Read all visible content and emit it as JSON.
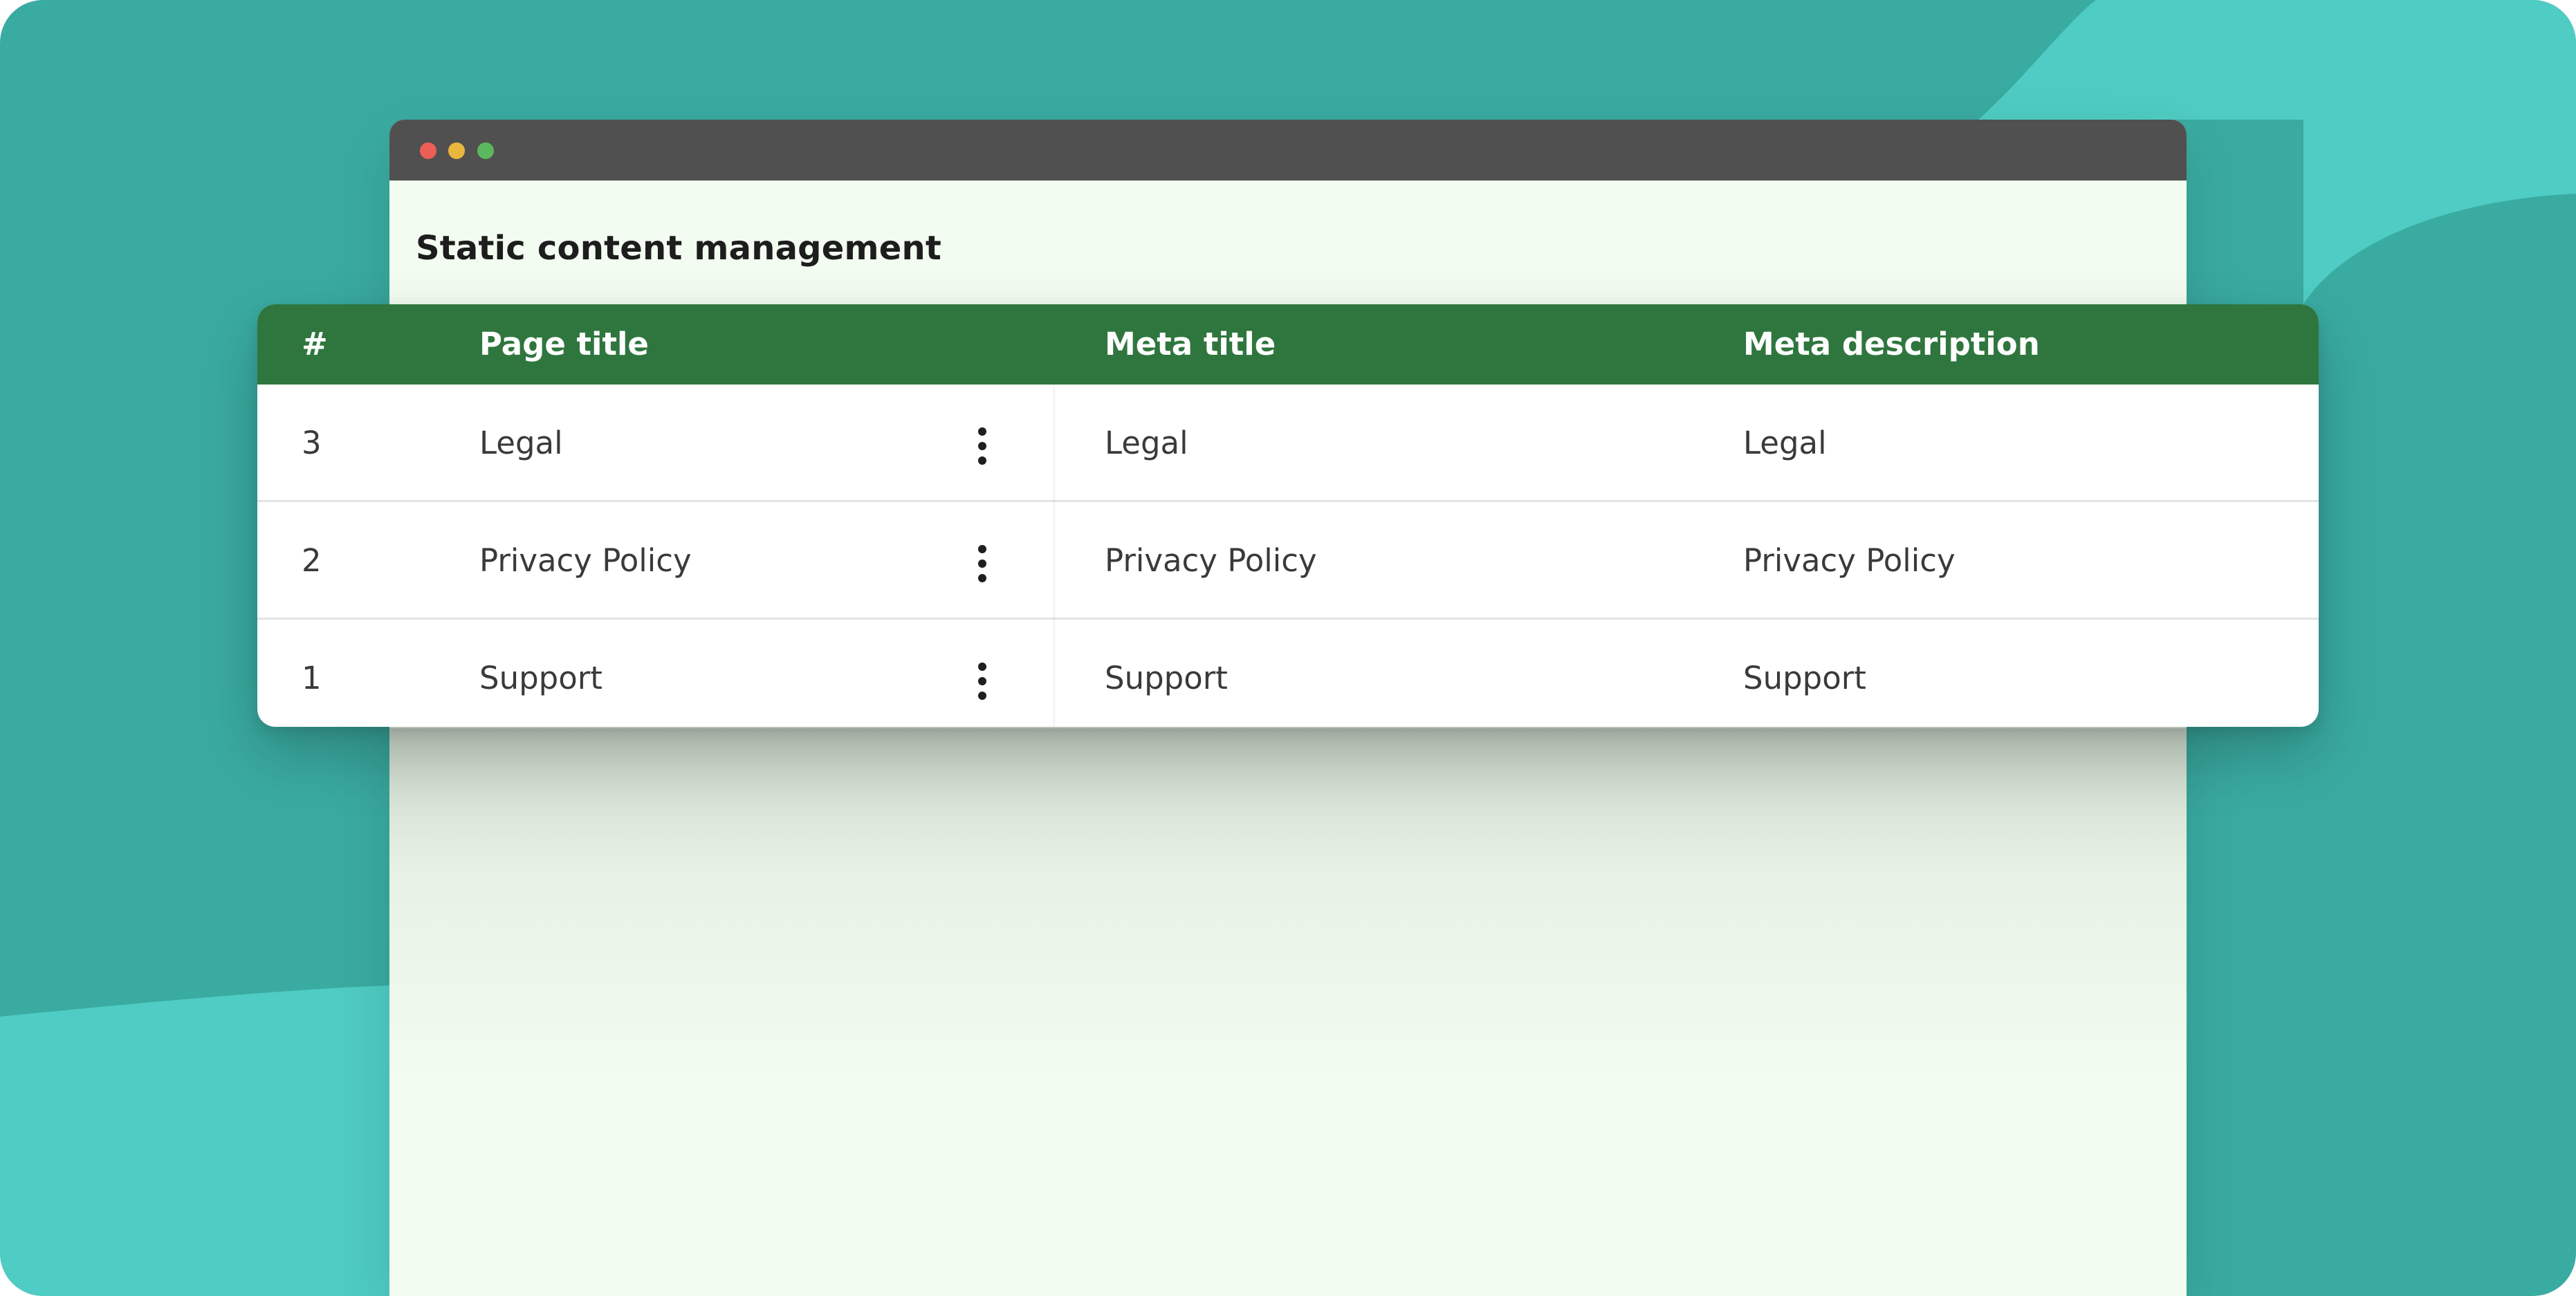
{
  "colors": {
    "background": "#3aaba1",
    "background_light": "#4fccc3",
    "window_body": "#f2fcf0",
    "titlebar": "#505050",
    "table_header": "#2f763e"
  },
  "window": {
    "traffic_lights": [
      "close",
      "minimize",
      "maximize"
    ],
    "title": "Static content management"
  },
  "table": {
    "headers": {
      "num": "#",
      "page_title": "Page title",
      "meta_title": "Meta title",
      "meta_description": "Meta description"
    },
    "rows": [
      {
        "num": "3",
        "page_title": "Legal",
        "meta_title": "Legal",
        "meta_description": "Legal",
        "actions_icon": "more-vertical-icon"
      },
      {
        "num": "2",
        "page_title": "Privacy Policy",
        "meta_title": "Privacy Policy",
        "meta_description": "Privacy Policy",
        "actions_icon": "more-vertical-icon"
      },
      {
        "num": "1",
        "page_title": "Support",
        "meta_title": "Support",
        "meta_description": "Support",
        "actions_icon": "more-vertical-icon"
      }
    ]
  }
}
